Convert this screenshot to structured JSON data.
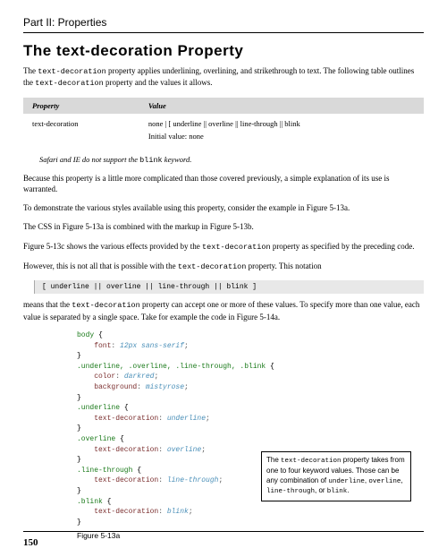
{
  "part_title": "Part II: Properties",
  "main_title": "The text-decoration Property",
  "intro_1a": "The ",
  "intro_1_code": "text-decoration",
  "intro_1b": " property applies underlining, overlining, and strikethrough to text. The following table outlines the ",
  "intro_1_code2": "text-decoration",
  "intro_1c": " property and the values it allows.",
  "table": {
    "header_property": "Property",
    "header_value": "Value",
    "row_property": "text-decoration",
    "row_value": "none | [ underline || overline || line-through || blink",
    "initial_value": "Initial value: none"
  },
  "note_1a": "Safari and IE do not support the ",
  "note_1_code": "blink",
  "note_1b": " keyword.",
  "para2": "Because this property is a little more complicated than those covered previously, a simple explanation of its use is warranted.",
  "para3": "To demonstrate the various styles available using this property, consider the example in Figure 5-13a.",
  "para4": "The CSS in Figure 5-13a is combined with the markup in Figure 5-13b.",
  "para5a": "Figure 5-13c shows the various effects provided by the ",
  "para5_code": "text-decoration",
  "para5b": " property as specified by the preceding code.",
  "para6a": "However, this is not all that is possible with the ",
  "para6_code": "text-decoration",
  "para6b": " property. This notation",
  "code_notation": "[ underline || overline || line-through || blink ]",
  "para7a": "means that the ",
  "para7_code": "text-decoration",
  "para7b": " property can accept one or more of these values. To specify more than one value, each value is separated by a single space. Take for example the code in Figure 5-14a.",
  "css": {
    "l1_sel": "body",
    "l1_brace": " {",
    "l2_prop": "    font",
    "l2_pun": ": ",
    "l2_val": "12px sans-serif",
    "l2_end": ";",
    "l3": "}",
    "l4_sel": ".underline, .overline, .line-through, .blink",
    "l4_brace": " {",
    "l5_prop": "    color",
    "l5_pun": ": ",
    "l5_val": "darkred",
    "l5_end": ";",
    "l6_prop": "    background",
    "l6_pun": ": ",
    "l6_val": "mistyrose",
    "l6_end": ";",
    "l7": "}",
    "l8_sel": ".underline",
    "l8_brace": " {",
    "l9_prop": "    text-decoration",
    "l9_pun": ": ",
    "l9_val": "underline",
    "l9_end": ";",
    "l10": "}",
    "l11_sel": ".overline",
    "l11_brace": " {",
    "l12_prop": "    text-decoration",
    "l12_pun": ": ",
    "l12_val": "overline",
    "l12_end": ";",
    "l13": "}",
    "l14_sel": ".line-through",
    "l14_brace": " {",
    "l15_prop": "    text-decoration",
    "l15_pun": ": ",
    "l15_val": "line-through",
    "l15_end": ";",
    "l16": "}",
    "l17_sel": ".blink",
    "l17_brace": " {",
    "l18_prop": "    text-decoration",
    "l18_pun": ": ",
    "l18_val": "blink",
    "l18_end": ";",
    "l19": "}"
  },
  "figure_label": "Figure 5-13a",
  "callout_1a": "The ",
  "callout_code1": "text-decoration",
  "callout_1b": " property takes from one to four keyword values. Those can be any combination of ",
  "callout_code2": "underline",
  "callout_comma1": ", ",
  "callout_code3": "overline",
  "callout_comma2": ", ",
  "callout_code4": "line-through",
  "callout_or": ", or ",
  "callout_code5": "blink",
  "callout_end": ".",
  "page_number": "150"
}
